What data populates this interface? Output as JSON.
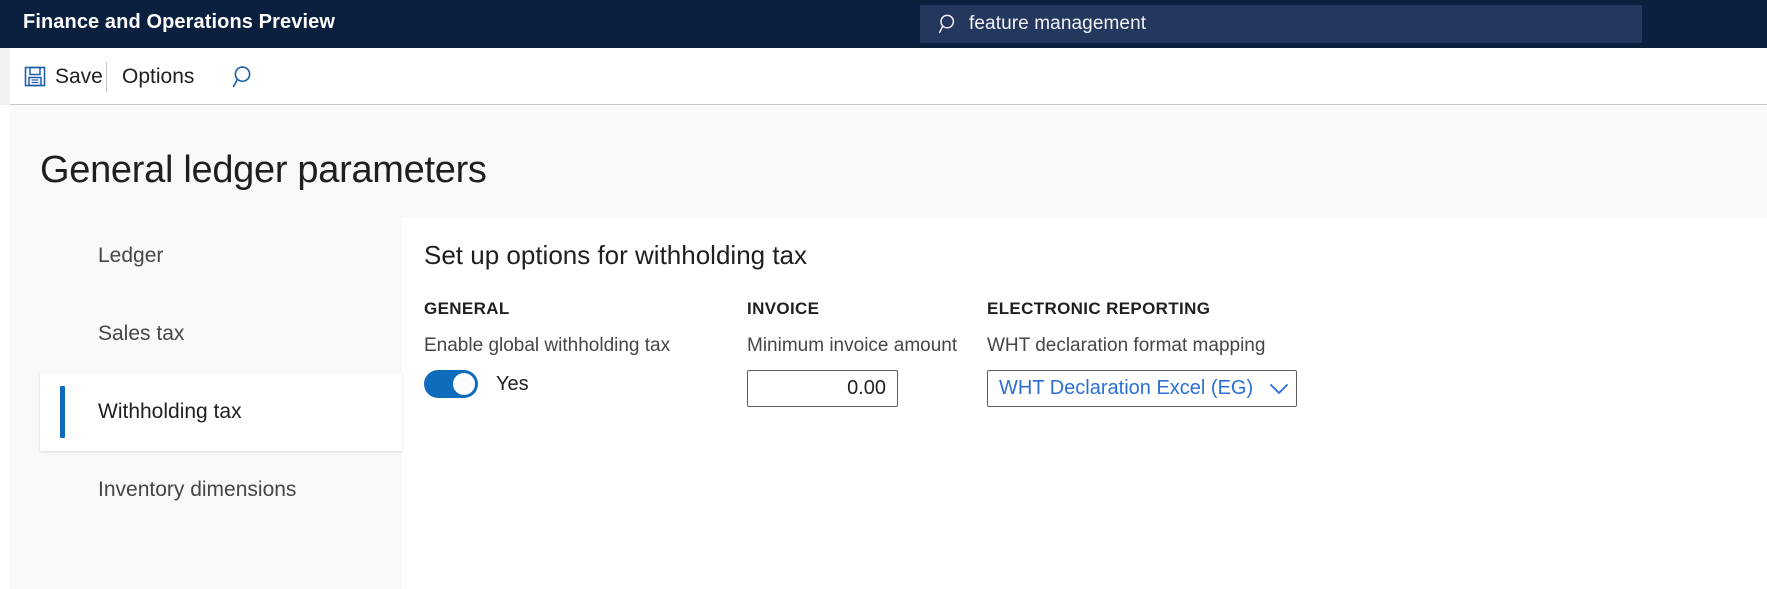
{
  "topbar": {
    "app_title": "Finance and Operations Preview",
    "background_color": "#0b1f3f",
    "search": {
      "icon": "search-icon",
      "value": "feature management",
      "placeholder": "Search for a page"
    }
  },
  "toolbar": {
    "save_label": "Save",
    "save_icon": "save-floppy-icon",
    "options_label": "Options",
    "search_icon": "search-icon"
  },
  "page": {
    "title": "General ledger parameters"
  },
  "sidebar": {
    "items": [
      {
        "label": "Ledger",
        "selected": false
      },
      {
        "label": "Sales tax",
        "selected": false
      },
      {
        "label": "Withholding tax",
        "selected": true
      },
      {
        "label": "Inventory dimensions",
        "selected": false
      }
    ],
    "selected_accent_color": "#0f6cbd"
  },
  "content": {
    "title": "Set up options for withholding tax",
    "groups": {
      "general": {
        "heading": "GENERAL",
        "field_label": "Enable global withholding tax",
        "toggle_value": "Yes",
        "toggle_on": true,
        "toggle_color": "#0f6cbd"
      },
      "invoice": {
        "heading": "INVOICE",
        "field_label": "Minimum invoice amount",
        "value": "0.00"
      },
      "electronic_reporting": {
        "heading": "ELECTRONIC REPORTING",
        "field_label": "WHT declaration format mapping",
        "value": "WHT Declaration Excel (EG)",
        "value_color": "#2b6fd6",
        "chevron_icon": "chevron-down-icon"
      }
    }
  }
}
